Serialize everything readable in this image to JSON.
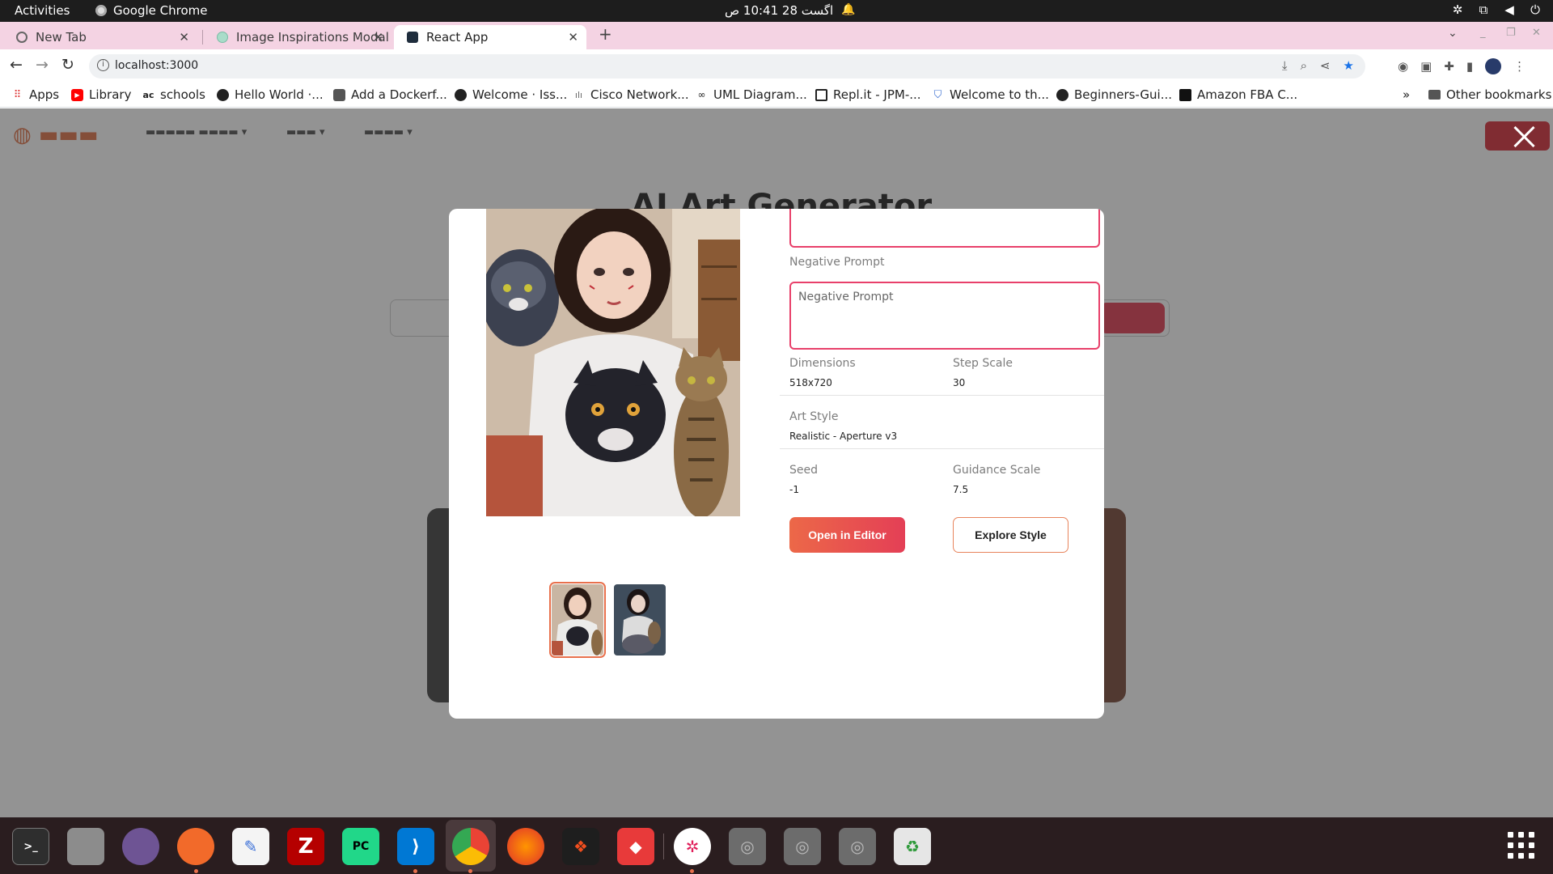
{
  "topbar": {
    "activities": "Activities",
    "app_name": "Google Chrome",
    "clock": "اگست 28  10:41 ص"
  },
  "tabs": [
    {
      "title": "New Tab"
    },
    {
      "title": "Image Inspirations Modal"
    },
    {
      "title": "React App"
    }
  ],
  "omnibox": {
    "url": "localhost:3000"
  },
  "bookmarks": [
    {
      "label": "Apps",
      "icon": "apps-grid-icon"
    },
    {
      "label": "Library",
      "icon": "youtube-icon"
    },
    {
      "label": "schools",
      "icon": "ac-icon"
    },
    {
      "label": "Hello World ·...",
      "icon": "github-icon"
    },
    {
      "label": "Add a Dockerf...",
      "icon": "docker-icon"
    },
    {
      "label": "Welcome · Iss...",
      "icon": "github-icon"
    },
    {
      "label": "Cisco Network...",
      "icon": "cisco-icon"
    },
    {
      "label": "UML Diagram...",
      "icon": "link-icon"
    },
    {
      "label": "Repl.it - JPM-...",
      "icon": "replit-icon"
    },
    {
      "label": "Welcome to th...",
      "icon": "shield-icon"
    },
    {
      "label": "Beginners-Gui...",
      "icon": "globe-icon"
    },
    {
      "label": "Amazon FBA C...",
      "icon": "bookmark-icon"
    }
  ],
  "bookmarks_more": "»",
  "other_bookmarks": "Other bookmarks",
  "modal": {
    "negative_prompt_label": "Negative Prompt",
    "negative_prompt_placeholder": "Negative Prompt",
    "dimensions_label": "Dimensions",
    "dimensions_value": "518x720",
    "step_scale_label": "Step Scale",
    "step_scale_value": "30",
    "art_style_label": "Art Style",
    "art_style_value": "Realistic - Aperture v3",
    "seed_label": "Seed",
    "seed_value": "-1",
    "guidance_scale_label": "Guidance Scale",
    "guidance_scale_value": "7.5",
    "open_editor_label": "Open in Editor",
    "explore_style_label": "Explore Style"
  },
  "background_page": {
    "heading": "AI Art Generator"
  },
  "colors": {
    "accent_start": "#ec6848",
    "accent_end": "#e43f56",
    "field_border": "#e8406a",
    "tab_strip": "#f4d3e3"
  }
}
